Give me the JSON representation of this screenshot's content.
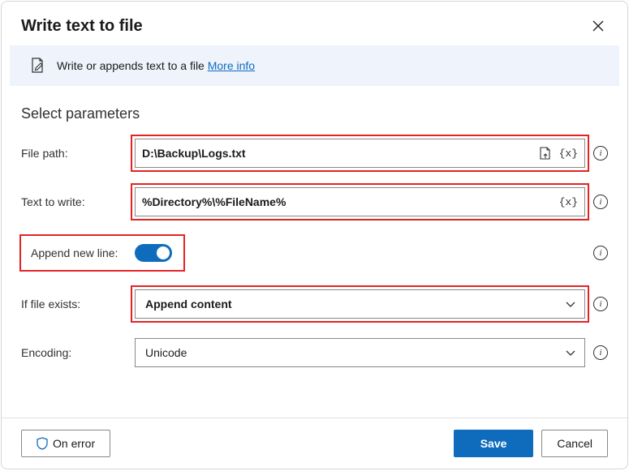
{
  "dialog": {
    "title": "Write text to file",
    "info_text": "Write or appends text to a file",
    "info_link": "More info",
    "section_title": "Select parameters"
  },
  "fields": {
    "file_path": {
      "label": "File path:",
      "value": "D:\\Backup\\Logs.txt"
    },
    "text_to_write": {
      "label": "Text to write:",
      "value": "%Directory%\\%FileName%"
    },
    "append_new_line": {
      "label": "Append new line:",
      "value": true
    },
    "if_file_exists": {
      "label": "If file exists:",
      "value": "Append content"
    },
    "encoding": {
      "label": "Encoding:",
      "value": "Unicode"
    }
  },
  "footer": {
    "on_error": "On error",
    "save": "Save",
    "cancel": "Cancel"
  }
}
